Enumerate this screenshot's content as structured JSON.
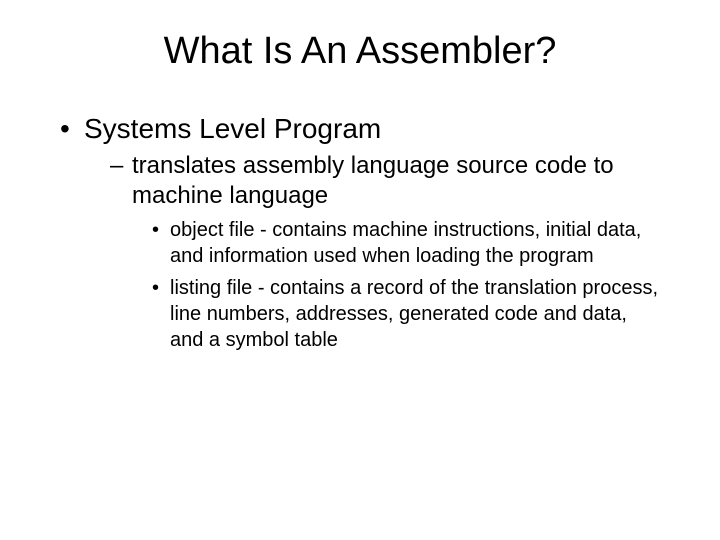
{
  "title": "What Is An Assembler?",
  "bullets": {
    "l1": "Systems Level Program",
    "l2": "translates assembly language source code to machine language",
    "l3a": "object file - contains machine instructions, initial data, and information used when loading the program",
    "l3b": "listing file - contains a record of the translation process, line numbers, addresses, generated code and data, and a symbol table"
  }
}
